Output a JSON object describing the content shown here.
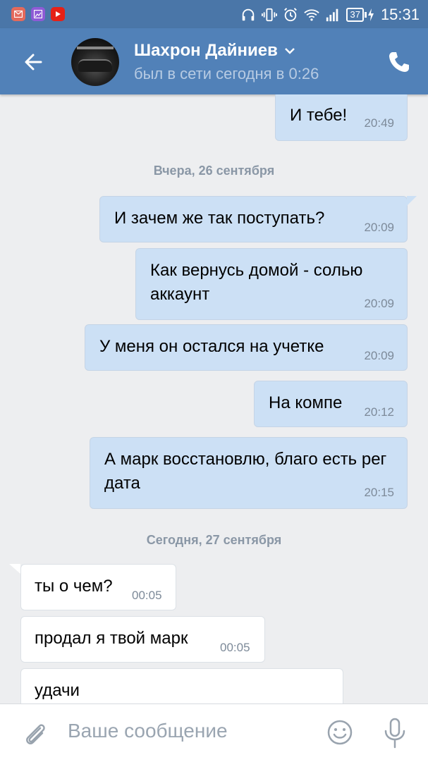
{
  "statusbar": {
    "battery": "37",
    "time": "15:31",
    "app_icons": [
      "mail-icon",
      "gallery-icon",
      "youtube-icon"
    ]
  },
  "header": {
    "name": "Шахрон Дайниев",
    "status": "был в сети сегодня в 0:26"
  },
  "messages": [
    {
      "dir": "out",
      "text": "И тебе!",
      "time": "20:49"
    },
    {
      "dir": "out",
      "text": "И зачем же так поступать?",
      "time": "20:09"
    },
    {
      "dir": "out",
      "text": "Как вернусь домой - солью аккаунт",
      "time": "20:09"
    },
    {
      "dir": "out",
      "text": "У меня он остался на учетке",
      "time": "20:09"
    },
    {
      "dir": "out",
      "text": "На компе",
      "time": "20:12"
    },
    {
      "dir": "out",
      "text": "А марк восстановлю, благо есть рег дата",
      "time": "20:15"
    },
    {
      "dir": "in",
      "text": "ты о чем?",
      "time": "00:05"
    },
    {
      "dir": "in",
      "text": "продал я твой марк",
      "time": "00:05"
    },
    {
      "dir": "in",
      "text": "удачи",
      "time": ""
    }
  ],
  "date_separators": [
    "Вчера, 26 сентября",
    "Сегодня, 27 сентября"
  ],
  "composer": {
    "placeholder": "Ваше сообщение"
  },
  "colors": {
    "header": "#5181b8",
    "statusbar": "#4a76a8",
    "outgoing_bubble": "#cce0f5",
    "incoming_bubble": "#ffffff",
    "background": "#edeef0"
  }
}
